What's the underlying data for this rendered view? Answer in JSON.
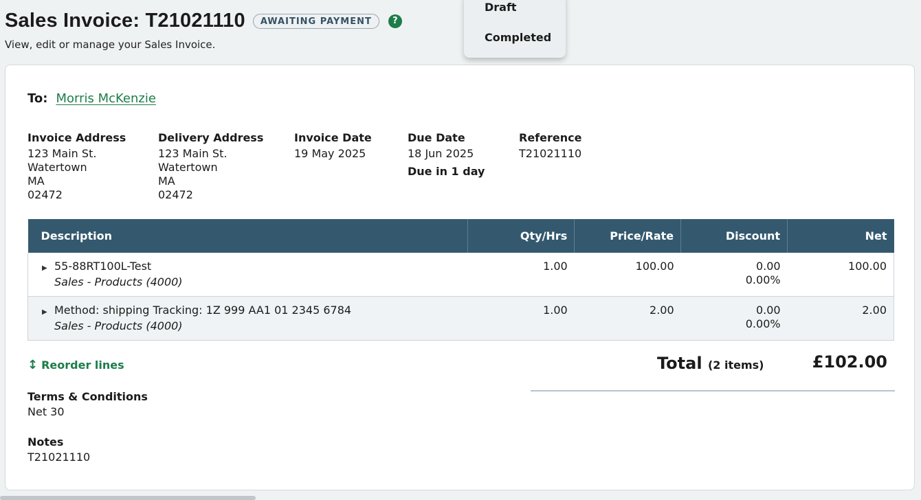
{
  "header": {
    "title": "Sales Invoice: T21021110",
    "status": "AWAITING PAYMENT",
    "help_glyph": "?",
    "subtitle": "View, edit or manage your Sales Invoice."
  },
  "status_menu": {
    "items": [
      "Draft",
      "Completed"
    ]
  },
  "invoice": {
    "to_label": "To:",
    "customer": "Morris McKenzie",
    "invoice_address": {
      "label": "Invoice Address",
      "lines": [
        "123 Main St.",
        "Watertown",
        "MA",
        "02472"
      ]
    },
    "delivery_address": {
      "label": "Delivery Address",
      "lines": [
        "123 Main St.",
        "Watertown",
        "MA",
        "02472"
      ]
    },
    "invoice_date": {
      "label": "Invoice Date",
      "value": "19 May 2025"
    },
    "due_date": {
      "label": "Due Date",
      "value": "18 Jun 2025",
      "note": "Due in 1 day"
    },
    "reference": {
      "label": "Reference",
      "value": "T21021110"
    }
  },
  "table": {
    "headers": [
      "Description",
      "Qty/Hrs",
      "Price/Rate",
      "Discount",
      "Net"
    ],
    "rows": [
      {
        "description": "55-88RT100L-Test",
        "category": "Sales - Products (4000)",
        "qty": "1.00",
        "price": "100.00",
        "discount": "0.00",
        "discount_pct": "0.00%",
        "net": "100.00"
      },
      {
        "description": "Method: shipping Tracking: 1Z 999 AA1 01 2345 6784",
        "category": "Sales - Products (4000)",
        "qty": "1.00",
        "price": "2.00",
        "discount": "0.00",
        "discount_pct": "0.00%",
        "net": "2.00"
      }
    ]
  },
  "reorder_label": "Reorder lines",
  "total": {
    "label": "Total",
    "count": "(2 items)",
    "value": "£102.00"
  },
  "terms": {
    "label": "Terms & Conditions",
    "value": "Net 30"
  },
  "notes": {
    "label": "Notes",
    "value": "T21021110"
  },
  "colors": {
    "accent": "#1c7d49",
    "table_header": "#34596f",
    "background": "#eff2f3"
  }
}
